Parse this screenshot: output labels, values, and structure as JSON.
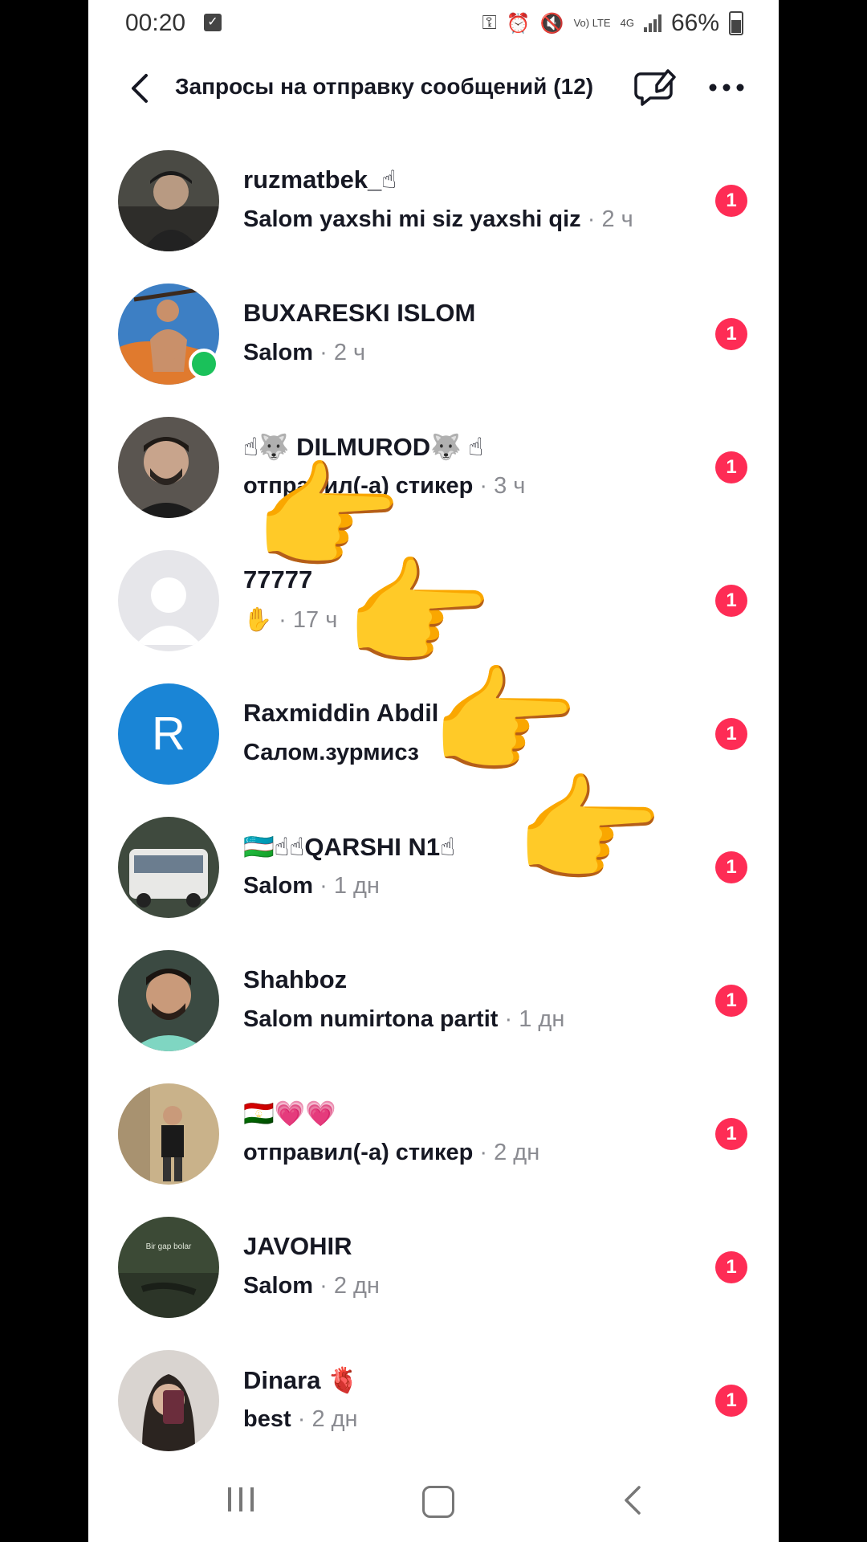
{
  "status_bar": {
    "time": "00:20",
    "battery": "66%",
    "network": "4G",
    "volte": "Vo) LTE"
  },
  "header": {
    "title": "Запросы на отправку сообщений",
    "count": "(12)",
    "back_icon": "chevron-left-icon",
    "edit_icon": "message-settings-icon",
    "more_icon": "more-dots-icon"
  },
  "requests": [
    {
      "name": "ruzmatbek_☝",
      "message": "Salom yaxshi mi siz yaxshi qiz",
      "sep": "·",
      "time": "2 ч",
      "badge": "1"
    },
    {
      "name": "BUXARESKI ISLOM",
      "message": "Salom",
      "sep": "·",
      "time": "2 ч",
      "badge": "1"
    },
    {
      "name": "☝🐺 DILMUROD🐺 ☝",
      "message": "отправил(-а) стикер",
      "sep": "·",
      "time": "3 ч",
      "badge": "1"
    },
    {
      "name": "77777",
      "message": "✋",
      "sep": "·",
      "time": "17 ч",
      "badge": "1"
    },
    {
      "name": "Raxmiddin Abdil",
      "message": "Салом.зурмисз",
      "sep": "",
      "time": "",
      "badge": "1",
      "initial": "R"
    },
    {
      "name": "🇺🇿☝☝QARSHI N1☝",
      "message": "Salom",
      "sep": "·",
      "time": "1 дн",
      "badge": "1"
    },
    {
      "name": "Shahboz",
      "message": "Salom numirtona partit",
      "sep": "·",
      "time": "1 дн",
      "badge": "1"
    },
    {
      "name": "🇹🇯💗💗",
      "message": "отправил(-а) стикер",
      "sep": "·",
      "time": "2 дн",
      "badge": "1"
    },
    {
      "name": "JAVOHIR",
      "message": "Salom",
      "sep": "·",
      "time": "2 дн",
      "badge": "1",
      "avatar_text": "Bir gap bolar"
    },
    {
      "name": "Dinara 🫀",
      "message": "best",
      "sep": "·",
      "time": "2 дн",
      "badge": "1"
    }
  ],
  "overlay_emoji": "👉",
  "colors": {
    "badge": "#fe2c55",
    "online": "#1ac15a",
    "letter_avatar": "#1a85d6",
    "text_primary": "#161823",
    "text_secondary": "#8a8b91"
  }
}
